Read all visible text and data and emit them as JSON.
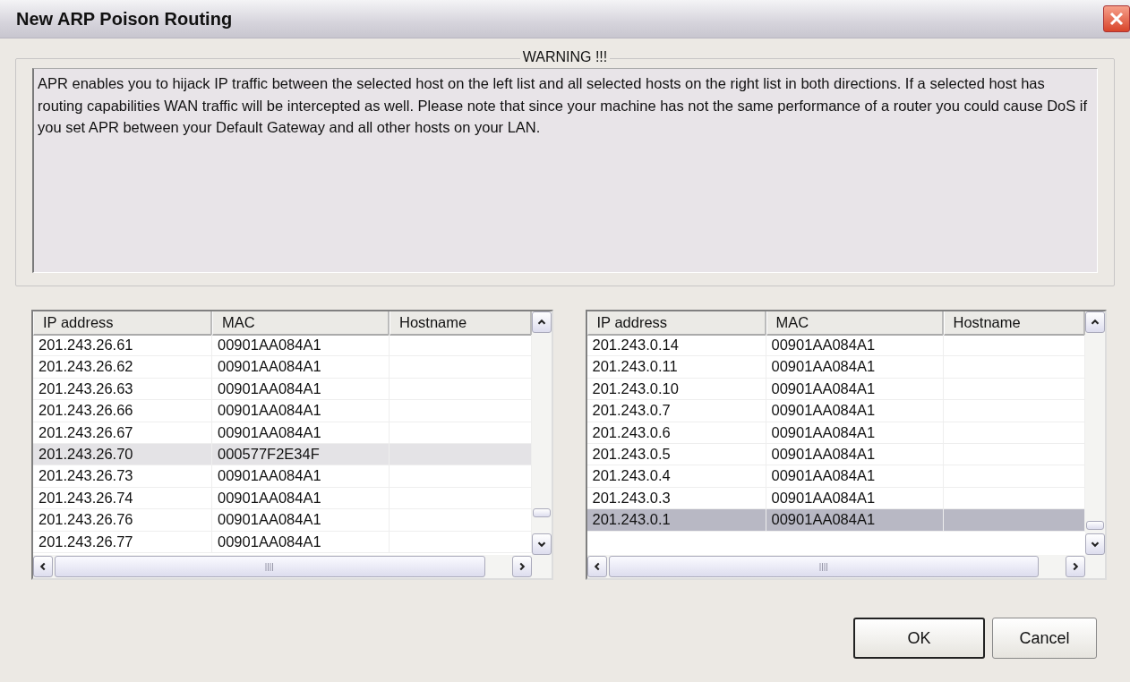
{
  "window": {
    "title": "New ARP Poison Routing"
  },
  "warning": {
    "title": "WARNING !!!",
    "text": "APR enables you to hijack IP traffic between the selected host on the left list and all selected hosts on the right list in both directions. If a selected host has routing capabilities WAN traffic will be intercepted as well. Please note that since your machine has not the same performance of a router you could cause DoS if you set APR between your Default Gateway and all other hosts on your LAN."
  },
  "lists": [
    {
      "focused": false,
      "columns": [
        "IP address",
        "MAC",
        "Hostname"
      ],
      "rows": [
        {
          "ip": "201.243.26.61",
          "mac": "00901AA084A1",
          "selected": false
        },
        {
          "ip": "201.243.26.62",
          "mac": "00901AA084A1",
          "selected": false
        },
        {
          "ip": "201.243.26.63",
          "mac": "00901AA084A1",
          "selected": false
        },
        {
          "ip": "201.243.26.66",
          "mac": "00901AA084A1",
          "selected": false
        },
        {
          "ip": "201.243.26.67",
          "mac": "00901AA084A1",
          "selected": false
        },
        {
          "ip": "201.243.26.70",
          "mac": "000577F2E34F",
          "selected": true
        },
        {
          "ip": "201.243.26.73",
          "mac": "00901AA084A1",
          "selected": false
        },
        {
          "ip": "201.243.26.74",
          "mac": "00901AA084A1",
          "selected": false
        },
        {
          "ip": "201.243.26.76",
          "mac": "00901AA084A1",
          "selected": false
        },
        {
          "ip": "201.243.26.77",
          "mac": "00901AA084A1",
          "selected": false
        }
      ]
    },
    {
      "focused": true,
      "columns": [
        "IP address",
        "MAC",
        "Hostname"
      ],
      "rows": [
        {
          "ip": "201.243.0.14",
          "mac": "00901AA084A1",
          "selected": false
        },
        {
          "ip": "201.243.0.11",
          "mac": "00901AA084A1",
          "selected": false
        },
        {
          "ip": "201.243.0.10",
          "mac": "00901AA084A1",
          "selected": false
        },
        {
          "ip": "201.243.0.7",
          "mac": "00901AA084A1",
          "selected": false
        },
        {
          "ip": "201.243.0.6",
          "mac": "00901AA084A1",
          "selected": false
        },
        {
          "ip": "201.243.0.5",
          "mac": "00901AA084A1",
          "selected": false
        },
        {
          "ip": "201.243.0.4",
          "mac": "00901AA084A1",
          "selected": false
        },
        {
          "ip": "201.243.0.3",
          "mac": "00901AA084A1",
          "selected": false
        },
        {
          "ip": "201.243.0.1",
          "mac": "00901AA084A1",
          "selected": true
        }
      ]
    }
  ],
  "buttons": [
    {
      "label": "OK",
      "default": true
    },
    {
      "label": "Cancel",
      "default": false
    }
  ]
}
